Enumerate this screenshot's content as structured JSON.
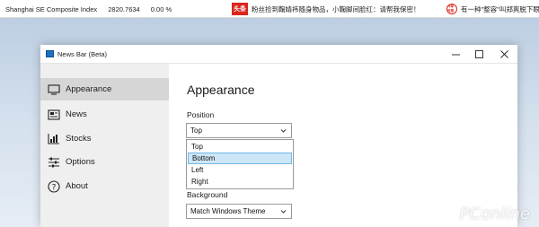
{
  "newsbar": {
    "index_name": "Shanghai SE Composite Index",
    "index_value": "2820.7634",
    "index_change": "0.00 %",
    "item1_source": "头条",
    "item1_text": "粉丝捡到鞠婧祎随身物品，小鞠脚间脸红：请帮我保密！",
    "item2_source": "环球时报",
    "item2_text": "有一种\"整容\"叫郑爽脱下眼镜"
  },
  "window": {
    "title": "News Bar (Beta)",
    "controls": {
      "minimize": "—",
      "maximize": "☐",
      "close": "✕"
    }
  },
  "sidebar": {
    "items": [
      {
        "label": "Appearance",
        "icon": "monitor-icon",
        "active": true
      },
      {
        "label": "News",
        "icon": "newspaper-icon"
      },
      {
        "label": "Stocks",
        "icon": "stocks-chart-icon"
      },
      {
        "label": "Options",
        "icon": "sliders-icon"
      },
      {
        "label": "About",
        "icon": "help-circle-icon"
      }
    ]
  },
  "content": {
    "title": "Appearance",
    "position_label": "Position",
    "position_value": "Top",
    "position_options": [
      "Top",
      "Bottom",
      "Left",
      "Right"
    ],
    "position_highlighted": "Bottom",
    "background_label": "Background",
    "background_value": "Match Windows Theme"
  },
  "watermark": "PConline",
  "colors": {
    "accent_selection": "#cde6f7",
    "selection_border": "#6fb7e6",
    "sidebar_bg": "#efefef",
    "sidebar_active": "#d6d6d6",
    "news_logo_red": "#d9251c"
  }
}
